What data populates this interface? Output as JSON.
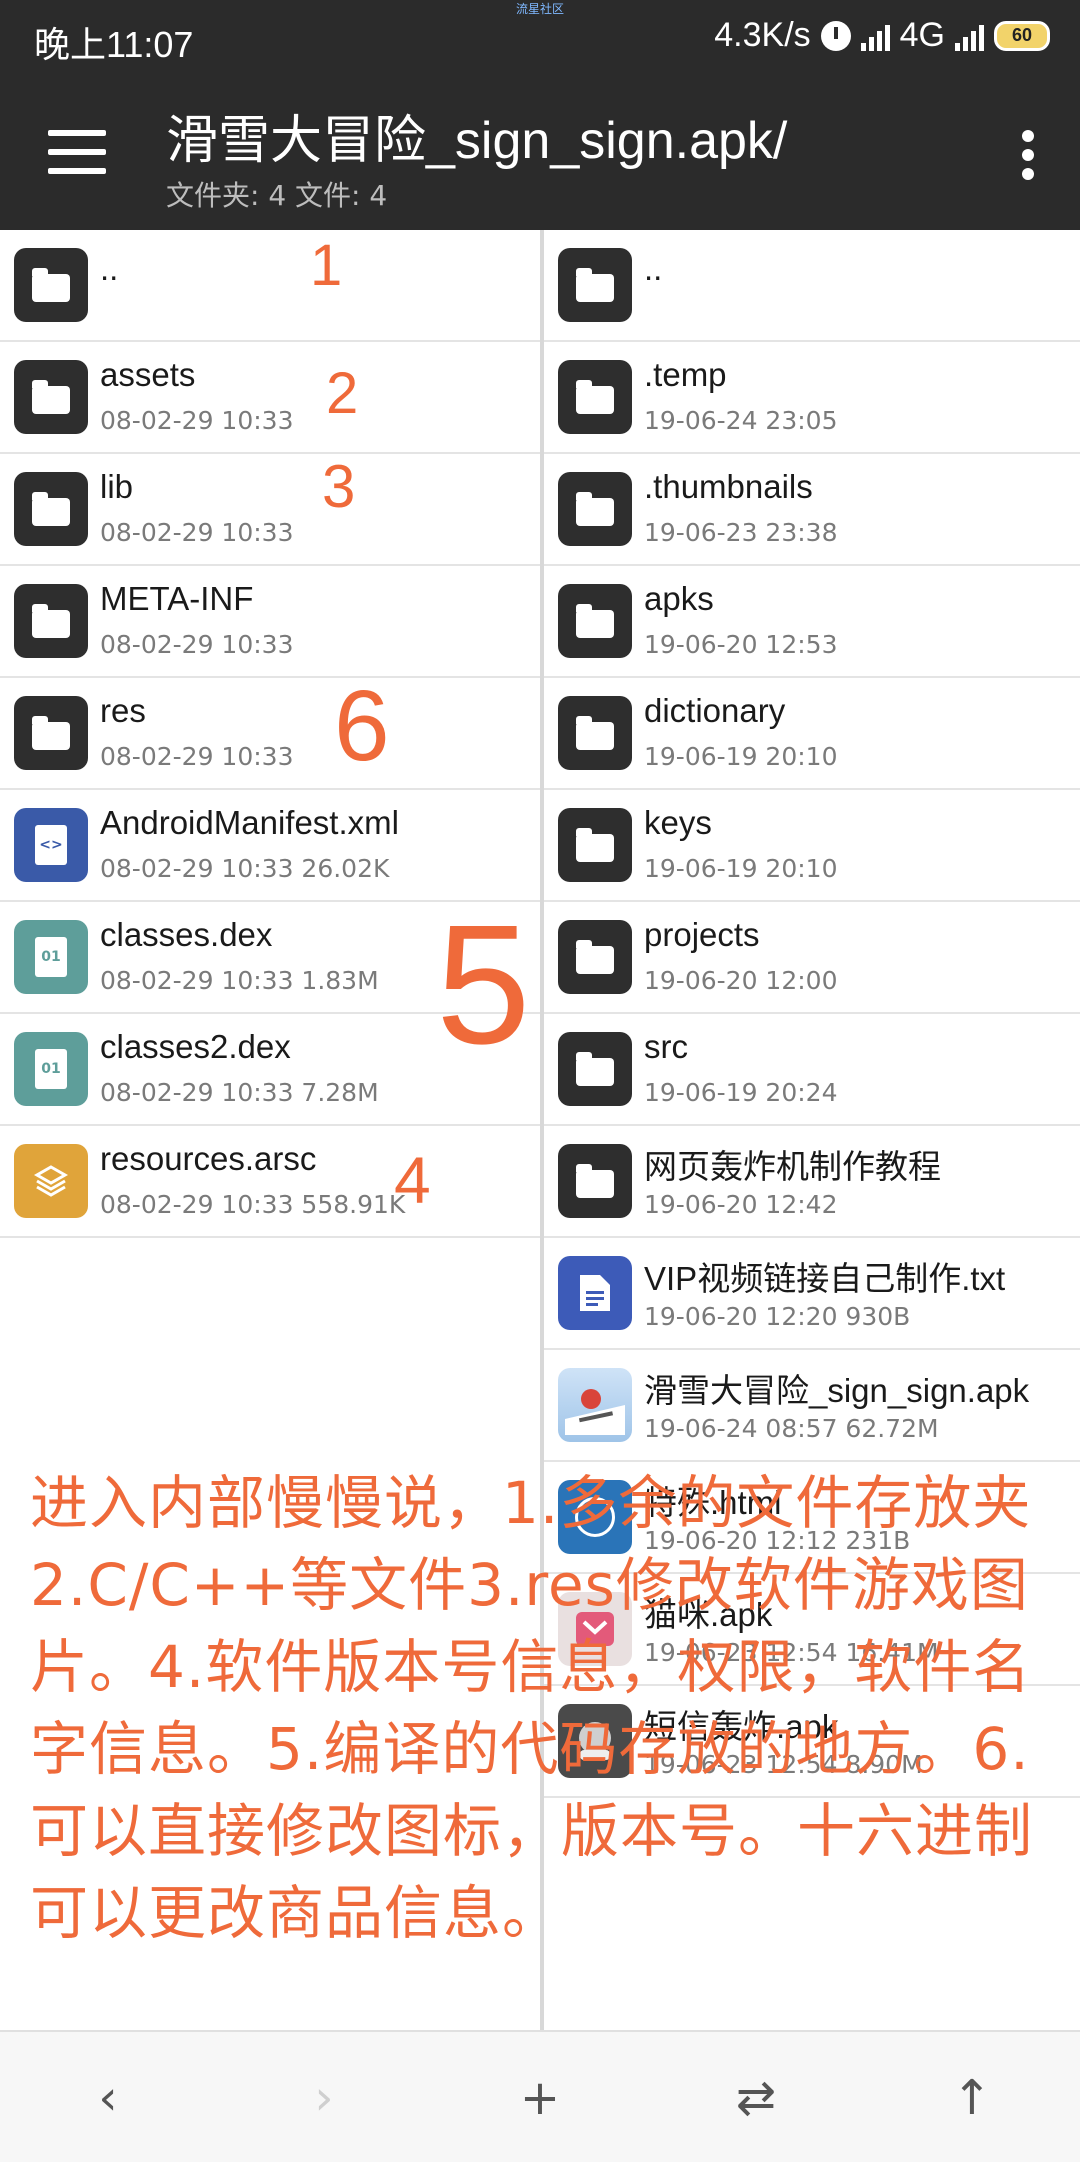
{
  "status": {
    "time": "晚上11:07",
    "watermark": "流星社区",
    "net_speed": "4.3K/s",
    "network": "4G",
    "battery": "60"
  },
  "appbar": {
    "title": "滑雪大冒险_sign_sign.apk/",
    "subtitle": "文件夹: 4  文件: 4",
    "menu_icon": "hamburger-menu-icon",
    "more_icon": "more-vert-icon"
  },
  "left_pane": {
    "items": [
      {
        "name": "..",
        "meta": "",
        "type": "folder"
      },
      {
        "name": "assets",
        "meta": "08-02-29 10:33",
        "type": "folder"
      },
      {
        "name": "lib",
        "meta": "08-02-29 10:33",
        "type": "folder"
      },
      {
        "name": "META-INF",
        "meta": "08-02-29 10:33",
        "type": "folder"
      },
      {
        "name": "res",
        "meta": "08-02-29 10:33",
        "type": "folder"
      },
      {
        "name": "AndroidManifest.xml",
        "meta": "08-02-29 10:33  26.02K",
        "type": "xml"
      },
      {
        "name": "classes.dex",
        "meta": "08-02-29 10:33  1.83M",
        "type": "dex"
      },
      {
        "name": "classes2.dex",
        "meta": "08-02-29 10:33  7.28M",
        "type": "dex"
      },
      {
        "name": "resources.arsc",
        "meta": "08-02-29 10:33  558.91K",
        "type": "arsc"
      }
    ]
  },
  "right_pane": {
    "items": [
      {
        "name": "..",
        "meta": "",
        "type": "folder"
      },
      {
        "name": ".temp",
        "meta": "19-06-24 23:05",
        "type": "folder"
      },
      {
        "name": ".thumbnails",
        "meta": "19-06-23 23:38",
        "type": "folder"
      },
      {
        "name": "apks",
        "meta": "19-06-20 12:53",
        "type": "folder"
      },
      {
        "name": "dictionary",
        "meta": "19-06-19 20:10",
        "type": "folder"
      },
      {
        "name": "keys",
        "meta": "19-06-19 20:10",
        "type": "folder"
      },
      {
        "name": "projects",
        "meta": "19-06-20 12:00",
        "type": "folder"
      },
      {
        "name": "src",
        "meta": "19-06-19 20:24",
        "type": "folder"
      },
      {
        "name": "网页轰炸机制作教程",
        "meta": "19-06-20 12:42",
        "type": "folder"
      },
      {
        "name": "VIP视频链接自己制作.txt",
        "meta": "19-06-20 12:20  930B",
        "type": "txt"
      },
      {
        "name": "滑雪大冒险_sign_sign.apk",
        "meta": "19-06-24 08:57  62.72M",
        "type": "apk"
      },
      {
        "name": "特殊.html",
        "meta": "19-06-20 12:12  231B",
        "type": "html"
      },
      {
        "name": "猫咪.apk",
        "meta": "19-06-23 12:54  16.41M",
        "type": "apk-cat"
      },
      {
        "name": "短信轰炸.apk",
        "meta": "19-06-23 12:54  8.90M",
        "type": "apk-sms"
      }
    ]
  },
  "annotations": {
    "n1": "1",
    "n2": "2",
    "n3": "3",
    "n4": "4",
    "n5": "5",
    "n6": "6",
    "overlay": "进入内部慢慢说，1.多余的文件存放夹2.C/C++等文件3.res修改软件游戏图片。4.软件版本号信息，权限，软件名字信息。5.编译的代码存放的地方。6.可以直接修改图标，版本号。十六进制可以更改商品信息。"
  },
  "bottombar": {
    "back": "‹",
    "forward": "›",
    "add": "+",
    "swap": "⇄",
    "up": "↑"
  }
}
